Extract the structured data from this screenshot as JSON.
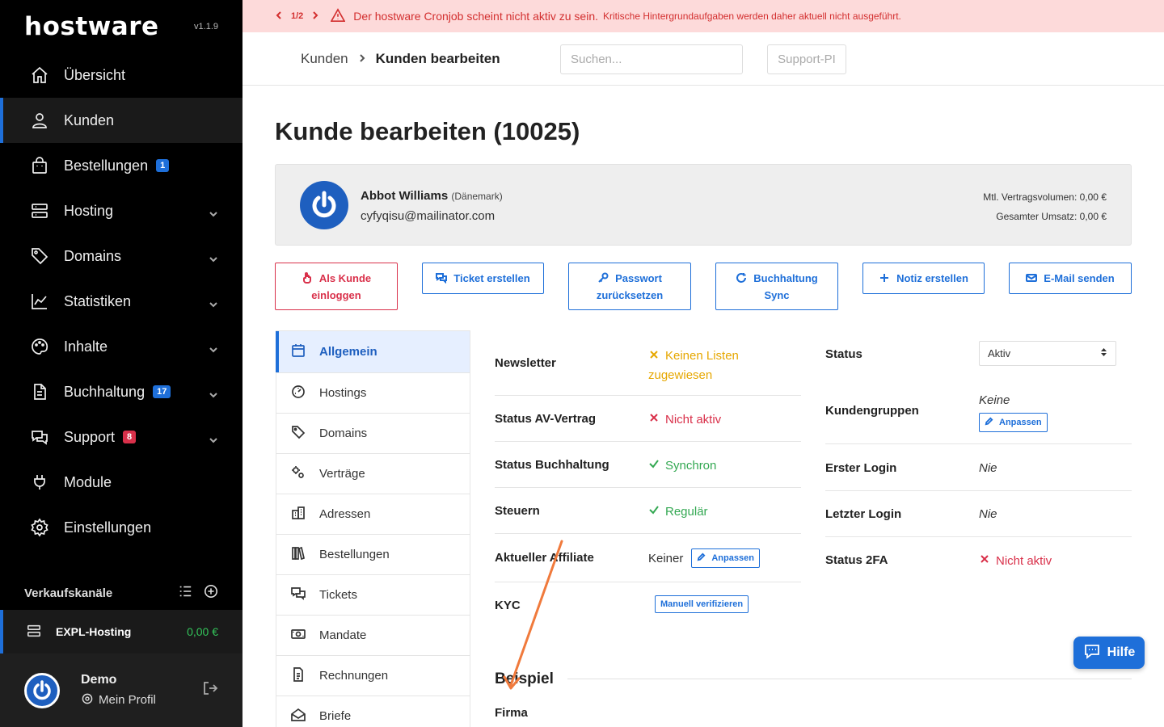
{
  "brand": {
    "logo": "hostware",
    "version": "v1.1.9"
  },
  "sidebar": {
    "items": [
      {
        "label": "Übersicht",
        "icon": "home-icon"
      },
      {
        "label": "Kunden",
        "icon": "user-icon"
      },
      {
        "label": "Bestellungen",
        "icon": "bag-icon",
        "badge": "1"
      },
      {
        "label": "Hosting",
        "icon": "server-icon"
      },
      {
        "label": "Domains",
        "icon": "tag-icon"
      },
      {
        "label": "Statistiken",
        "icon": "chart-icon"
      },
      {
        "label": "Inhalte",
        "icon": "palette-icon"
      },
      {
        "label": "Buchhaltung",
        "icon": "document-icon",
        "badge": "17"
      },
      {
        "label": "Support",
        "icon": "chat-icon",
        "badge": "8"
      },
      {
        "label": "Module",
        "icon": "plug-icon"
      },
      {
        "label": "Einstellungen",
        "icon": "gear-icon"
      }
    ],
    "channels_title": "Verkaufskanäle",
    "channel": {
      "name": "EXPL-Hosting",
      "amount": "0,00 €"
    },
    "profile": {
      "name": "Demo",
      "link": "Mein Profil"
    }
  },
  "alert": {
    "pager": "1/2",
    "message": "Der hostware Cronjob scheint nicht aktiv zu sein.",
    "detail": "Kritische Hintergrundaufgaben werden daher aktuell nicht ausgeführt."
  },
  "header": {
    "crumb_parent": "Kunden",
    "crumb_current": "Kunden bearbeiten",
    "search_placeholder": "Suchen...",
    "support_pi": "Support-PI"
  },
  "page": {
    "title": "Kunde bearbeiten (10025)"
  },
  "customer": {
    "name": "Abbot Williams",
    "country": "(Dänemark)",
    "email": "cyfyqisu@mailinator.com",
    "contract_volume": "Mtl. Vertragsvolumen: 0,00 €",
    "total_revenue": "Gesamter Umsatz: 0,00 €"
  },
  "actions": {
    "login_as": [
      "Als Kunde",
      "einloggen"
    ],
    "ticket": "Ticket erstellen",
    "password": [
      "Passwort",
      "zurücksetzen"
    ],
    "sync": [
      "Buchhaltung",
      "Sync"
    ],
    "note": "Notiz erstellen",
    "email": "E-Mail senden"
  },
  "tabs": [
    {
      "label": "Allgemein",
      "icon": "calendar-icon"
    },
    {
      "label": "Hostings",
      "icon": "dashboard-icon"
    },
    {
      "label": "Domains",
      "icon": "tag-icon"
    },
    {
      "label": "Verträge",
      "icon": "cogs-icon"
    },
    {
      "label": "Adressen",
      "icon": "building-icon"
    },
    {
      "label": "Bestellungen",
      "icon": "books-icon"
    },
    {
      "label": "Tickets",
      "icon": "chat-icon"
    },
    {
      "label": "Mandate",
      "icon": "money-icon"
    },
    {
      "label": "Rechnungen",
      "icon": "invoice-icon"
    },
    {
      "label": "Briefe",
      "icon": "envelope-open-icon"
    }
  ],
  "info_left": {
    "newsletter": {
      "label": "Newsletter",
      "value": [
        "Keinen Listen",
        "zugewiesen"
      ]
    },
    "av": {
      "label": "Status AV-Vertrag",
      "value": "Nicht aktiv"
    },
    "accounting": {
      "label": "Status Buchhaltung",
      "value": "Synchron"
    },
    "tax": {
      "label": "Steuern",
      "value": "Regulär"
    },
    "affiliate": {
      "label": "Aktueller Affiliate",
      "value": "Keiner",
      "button": "Anpassen"
    },
    "kyc": {
      "label": "KYC",
      "button": "Manuell verifizieren"
    }
  },
  "info_right": {
    "status": {
      "label": "Status",
      "value": "Aktiv"
    },
    "groups": {
      "label": "Kundengruppen",
      "value": "Keine",
      "button": "Anpassen"
    },
    "first_login": {
      "label": "Erster Login",
      "value": "Nie"
    },
    "last_login": {
      "label": "Letzter Login",
      "value": "Nie"
    },
    "twofa": {
      "label": "Status 2FA",
      "value": "Nicht aktiv"
    }
  },
  "section": {
    "title": "Beispiel",
    "firma": "Firma"
  },
  "help": {
    "label": "Hilfe"
  },
  "colors": {
    "accent": "#1e6fd9",
    "danger": "#d9304a",
    "success": "#33a852",
    "warning": "#e6a700"
  }
}
